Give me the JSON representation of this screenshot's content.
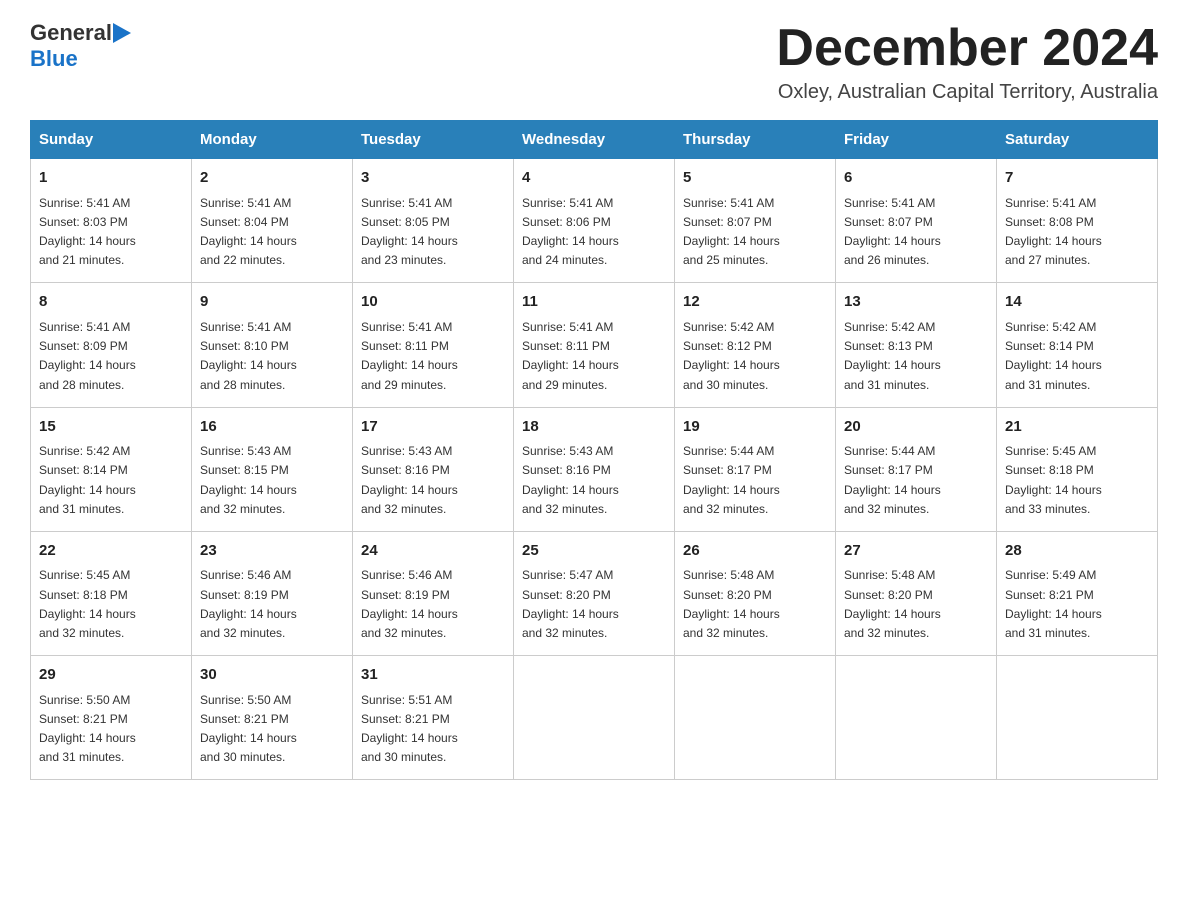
{
  "logo": {
    "general": "General",
    "blue": "Blue"
  },
  "title": {
    "month_year": "December 2024",
    "location": "Oxley, Australian Capital Territory, Australia"
  },
  "weekdays": [
    "Sunday",
    "Monday",
    "Tuesday",
    "Wednesday",
    "Thursday",
    "Friday",
    "Saturday"
  ],
  "weeks": [
    [
      {
        "day": "1",
        "sunrise": "5:41 AM",
        "sunset": "8:03 PM",
        "daylight": "14 hours and 21 minutes."
      },
      {
        "day": "2",
        "sunrise": "5:41 AM",
        "sunset": "8:04 PM",
        "daylight": "14 hours and 22 minutes."
      },
      {
        "day": "3",
        "sunrise": "5:41 AM",
        "sunset": "8:05 PM",
        "daylight": "14 hours and 23 minutes."
      },
      {
        "day": "4",
        "sunrise": "5:41 AM",
        "sunset": "8:06 PM",
        "daylight": "14 hours and 24 minutes."
      },
      {
        "day": "5",
        "sunrise": "5:41 AM",
        "sunset": "8:07 PM",
        "daylight": "14 hours and 25 minutes."
      },
      {
        "day": "6",
        "sunrise": "5:41 AM",
        "sunset": "8:07 PM",
        "daylight": "14 hours and 26 minutes."
      },
      {
        "day": "7",
        "sunrise": "5:41 AM",
        "sunset": "8:08 PM",
        "daylight": "14 hours and 27 minutes."
      }
    ],
    [
      {
        "day": "8",
        "sunrise": "5:41 AM",
        "sunset": "8:09 PM",
        "daylight": "14 hours and 28 minutes."
      },
      {
        "day": "9",
        "sunrise": "5:41 AM",
        "sunset": "8:10 PM",
        "daylight": "14 hours and 28 minutes."
      },
      {
        "day": "10",
        "sunrise": "5:41 AM",
        "sunset": "8:11 PM",
        "daylight": "14 hours and 29 minutes."
      },
      {
        "day": "11",
        "sunrise": "5:41 AM",
        "sunset": "8:11 PM",
        "daylight": "14 hours and 29 minutes."
      },
      {
        "day": "12",
        "sunrise": "5:42 AM",
        "sunset": "8:12 PM",
        "daylight": "14 hours and 30 minutes."
      },
      {
        "day": "13",
        "sunrise": "5:42 AM",
        "sunset": "8:13 PM",
        "daylight": "14 hours and 31 minutes."
      },
      {
        "day": "14",
        "sunrise": "5:42 AM",
        "sunset": "8:14 PM",
        "daylight": "14 hours and 31 minutes."
      }
    ],
    [
      {
        "day": "15",
        "sunrise": "5:42 AM",
        "sunset": "8:14 PM",
        "daylight": "14 hours and 31 minutes."
      },
      {
        "day": "16",
        "sunrise": "5:43 AM",
        "sunset": "8:15 PM",
        "daylight": "14 hours and 32 minutes."
      },
      {
        "day": "17",
        "sunrise": "5:43 AM",
        "sunset": "8:16 PM",
        "daylight": "14 hours and 32 minutes."
      },
      {
        "day": "18",
        "sunrise": "5:43 AM",
        "sunset": "8:16 PM",
        "daylight": "14 hours and 32 minutes."
      },
      {
        "day": "19",
        "sunrise": "5:44 AM",
        "sunset": "8:17 PM",
        "daylight": "14 hours and 32 minutes."
      },
      {
        "day": "20",
        "sunrise": "5:44 AM",
        "sunset": "8:17 PM",
        "daylight": "14 hours and 32 minutes."
      },
      {
        "day": "21",
        "sunrise": "5:45 AM",
        "sunset": "8:18 PM",
        "daylight": "14 hours and 33 minutes."
      }
    ],
    [
      {
        "day": "22",
        "sunrise": "5:45 AM",
        "sunset": "8:18 PM",
        "daylight": "14 hours and 32 minutes."
      },
      {
        "day": "23",
        "sunrise": "5:46 AM",
        "sunset": "8:19 PM",
        "daylight": "14 hours and 32 minutes."
      },
      {
        "day": "24",
        "sunrise": "5:46 AM",
        "sunset": "8:19 PM",
        "daylight": "14 hours and 32 minutes."
      },
      {
        "day": "25",
        "sunrise": "5:47 AM",
        "sunset": "8:20 PM",
        "daylight": "14 hours and 32 minutes."
      },
      {
        "day": "26",
        "sunrise": "5:48 AM",
        "sunset": "8:20 PM",
        "daylight": "14 hours and 32 minutes."
      },
      {
        "day": "27",
        "sunrise": "5:48 AM",
        "sunset": "8:20 PM",
        "daylight": "14 hours and 32 minutes."
      },
      {
        "day": "28",
        "sunrise": "5:49 AM",
        "sunset": "8:21 PM",
        "daylight": "14 hours and 31 minutes."
      }
    ],
    [
      {
        "day": "29",
        "sunrise": "5:50 AM",
        "sunset": "8:21 PM",
        "daylight": "14 hours and 31 minutes."
      },
      {
        "day": "30",
        "sunrise": "5:50 AM",
        "sunset": "8:21 PM",
        "daylight": "14 hours and 30 minutes."
      },
      {
        "day": "31",
        "sunrise": "5:51 AM",
        "sunset": "8:21 PM",
        "daylight": "14 hours and 30 minutes."
      },
      null,
      null,
      null,
      null
    ]
  ],
  "labels": {
    "sunrise": "Sunrise:",
    "sunset": "Sunset:",
    "daylight": "Daylight:"
  }
}
